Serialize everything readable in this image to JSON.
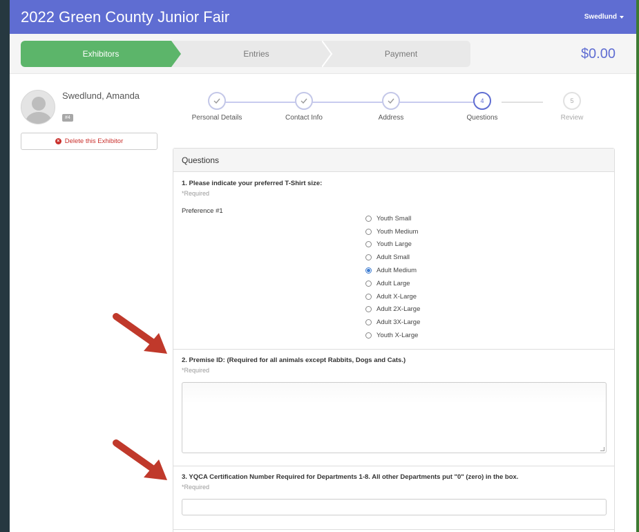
{
  "app": {
    "title": "2022 Green County Junior Fair"
  },
  "user": {
    "name": "Swedlund"
  },
  "wizard": {
    "steps": [
      "Exhibitors",
      "Entries",
      "Payment"
    ],
    "total": "$0.00"
  },
  "exhibitor": {
    "name": "Swedlund, Amanda",
    "badge": "#4",
    "delete_label": "Delete this Exhibitor"
  },
  "progress": [
    {
      "label": "Personal Details",
      "status": "done"
    },
    {
      "label": "Contact Info",
      "status": "done"
    },
    {
      "label": "Address",
      "status": "done"
    },
    {
      "label": "Questions",
      "status": "current",
      "number": "4"
    },
    {
      "label": "Review",
      "status": "todo",
      "number": "5"
    }
  ],
  "panel": {
    "title": "Questions"
  },
  "questions": [
    {
      "title": "1. Please indicate your preferred T-Shirt size:",
      "required": "*Required",
      "preference_label": "Preference #1",
      "options": [
        "Youth Small",
        "Youth Medium",
        "Youth Large",
        "Adult Small",
        "Adult Medium",
        "Adult Large",
        "Adult X-Large",
        "Adult 2X-Large",
        "Adult 3X-Large",
        "Youth X-Large"
      ],
      "selected": "Adult Medium"
    },
    {
      "title": "2. Premise ID: (Required for all animals except Rabbits, Dogs and Cats.)",
      "required": "*Required",
      "value": ""
    },
    {
      "title": "3. YQCA Certification Number Required for Departments 1-8. All other Departments put \"0\" (zero) in the box.",
      "required": "*Required",
      "value": ""
    }
  ],
  "colors": {
    "header": "#5f6dd2",
    "active_step": "#5cb56a",
    "arrow": "#c0392b",
    "danger": "#c9302c"
  }
}
